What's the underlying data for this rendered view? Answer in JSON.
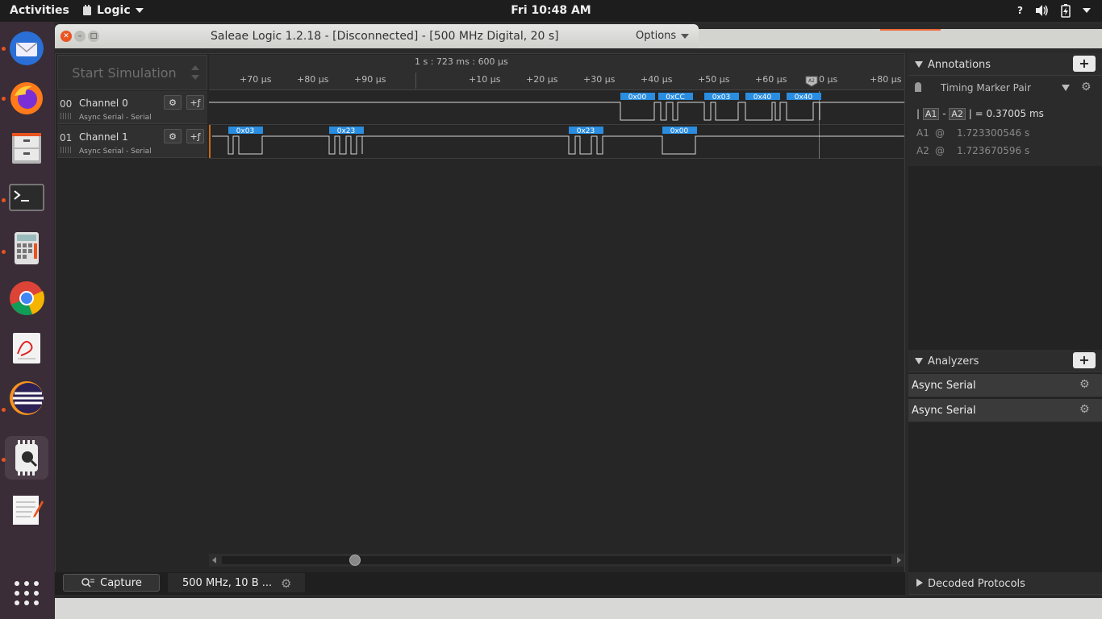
{
  "topbar": {
    "activities": "Activities",
    "app_name": "Logic",
    "clock": "Fri 10:48 AM",
    "help": "?"
  },
  "dock": {
    "items": [
      "thunderbird",
      "firefox",
      "files",
      "terminal",
      "calculator",
      "chrome",
      "document-viewer",
      "eclipse",
      "saleae-logic",
      "text-editor"
    ]
  },
  "window": {
    "title": "Saleae Logic 1.2.18 - [Disconnected] - [500 MHz Digital, 20 s]",
    "options_label": "Options"
  },
  "simulation": {
    "button_label": "Start Simulation"
  },
  "ruler": {
    "center_time": "1 s : 723 ms : 600 µs",
    "ticks": [
      "+70 µs",
      "+80 µs",
      "+90 µs",
      "+10 µs",
      "+20 µs",
      "+30 µs",
      "+40 µs",
      "+50 µs",
      "+60 µs",
      "0 µs",
      "+80 µs"
    ]
  },
  "channels": [
    {
      "num": "00",
      "name": "Channel 0",
      "analyzer": "Async Serial - Serial",
      "decoded": [
        "0x00",
        "0xCC",
        "0x03",
        "0x40",
        "0x40"
      ]
    },
    {
      "num": "01",
      "name": "Channel 1",
      "analyzer": "Async Serial - Serial",
      "decoded": [
        "0x03",
        "0x23",
        "0x23",
        "0x00"
      ]
    }
  ],
  "marker_label": "A2",
  "bottom": {
    "capture_label": "Capture",
    "capture_info": "500 MHz, 10 B ..."
  },
  "annotations": {
    "header": "Annotations",
    "marker_pair": "Timing Marker Pair",
    "a1": "A1",
    "a2": "A2",
    "minus": "-",
    "equals": "=",
    "delta": "0.37005 ms",
    "at": "@",
    "a1_time": "1.723300546 s",
    "a2_time": "1.723670596 s"
  },
  "analyzers": {
    "header": "Analyzers",
    "items": [
      "Async Serial",
      "Async Serial"
    ]
  },
  "decoded_protocols": {
    "header": "Decoded Protocols"
  },
  "colors": {
    "accent": "#e95420",
    "decode_blue": "#2a8de0",
    "wave": "#d8d8d8"
  }
}
